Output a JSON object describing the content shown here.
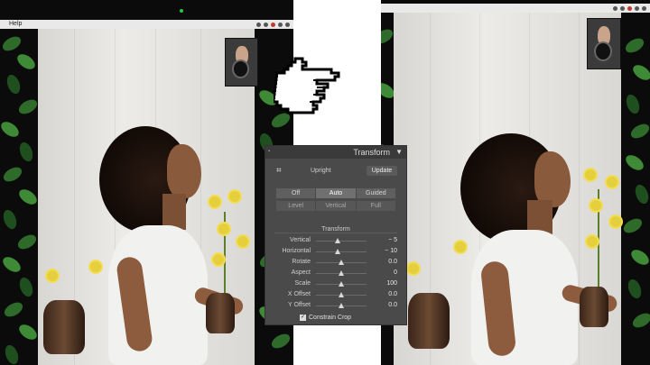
{
  "menu": {
    "help": "Help"
  },
  "panel": {
    "title": "Transform",
    "upright_label": "Upright",
    "update_label": "Update",
    "upright_buttons": [
      {
        "label": "Off",
        "state": "normal"
      },
      {
        "label": "Auto",
        "state": "active"
      },
      {
        "label": "Guided",
        "state": "normal"
      }
    ],
    "upright_buttons_row2": [
      {
        "label": "Level",
        "state": "dim"
      },
      {
        "label": "Vertical",
        "state": "dim"
      },
      {
        "label": "Full",
        "state": "dim"
      }
    ],
    "section_label": "Transform",
    "sliders": [
      {
        "label": "Vertical",
        "value": "− 5"
      },
      {
        "label": "Horizontal",
        "value": "− 10"
      },
      {
        "label": "Rotate",
        "value": "0.0"
      },
      {
        "label": "Aspect",
        "value": "0"
      },
      {
        "label": "Scale",
        "value": "100"
      },
      {
        "label": "X Offset",
        "value": "0.0"
      },
      {
        "label": "Y Offset",
        "value": "0.0"
      }
    ],
    "constrain_crop_label": "Constrain Crop",
    "constrain_crop_checked": true
  },
  "icons": {
    "crop": "crop-icon",
    "pointer": "pointing-hand-icon",
    "collapse": "triangle-down-icon"
  },
  "colors": {
    "panel_bg": "#4a4a4a",
    "panel_header": "#3a3a3a",
    "active_segment": "#707070"
  }
}
